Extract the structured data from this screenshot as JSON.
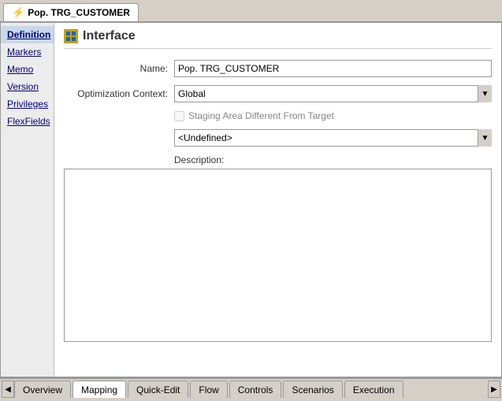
{
  "topTab": {
    "label": "Pop. TRG_CUSTOMER",
    "icon": "⚡"
  },
  "sidebar": {
    "items": [
      {
        "id": "definition",
        "label": "Definition",
        "active": true
      },
      {
        "id": "markers",
        "label": "Markers"
      },
      {
        "id": "memo",
        "label": "Memo"
      },
      {
        "id": "version",
        "label": "Version"
      },
      {
        "id": "privileges",
        "label": "Privileges"
      },
      {
        "id": "flexfields",
        "label": "FlexFields"
      }
    ]
  },
  "content": {
    "header": "Interface",
    "headerIcon": "⬡",
    "fields": {
      "nameLabel": "Name:",
      "nameValue": "Pop. TRG_CUSTOMER",
      "optimizationLabel": "Optimization Context:",
      "optimizationValue": "Global",
      "stagingLabel": "Staging Area Different From Target",
      "undefinedOption": "<Undefined>",
      "descriptionLabel": "Description:"
    }
  },
  "bottomTabs": {
    "items": [
      {
        "id": "overview",
        "label": "Overview"
      },
      {
        "id": "mapping",
        "label": "Mapping",
        "active": true
      },
      {
        "id": "quick-edit",
        "label": "Quick-Edit"
      },
      {
        "id": "flow",
        "label": "Flow"
      },
      {
        "id": "controls",
        "label": "Controls"
      },
      {
        "id": "scenarios",
        "label": "Scenarios"
      },
      {
        "id": "execution",
        "label": "Execution"
      }
    ]
  }
}
